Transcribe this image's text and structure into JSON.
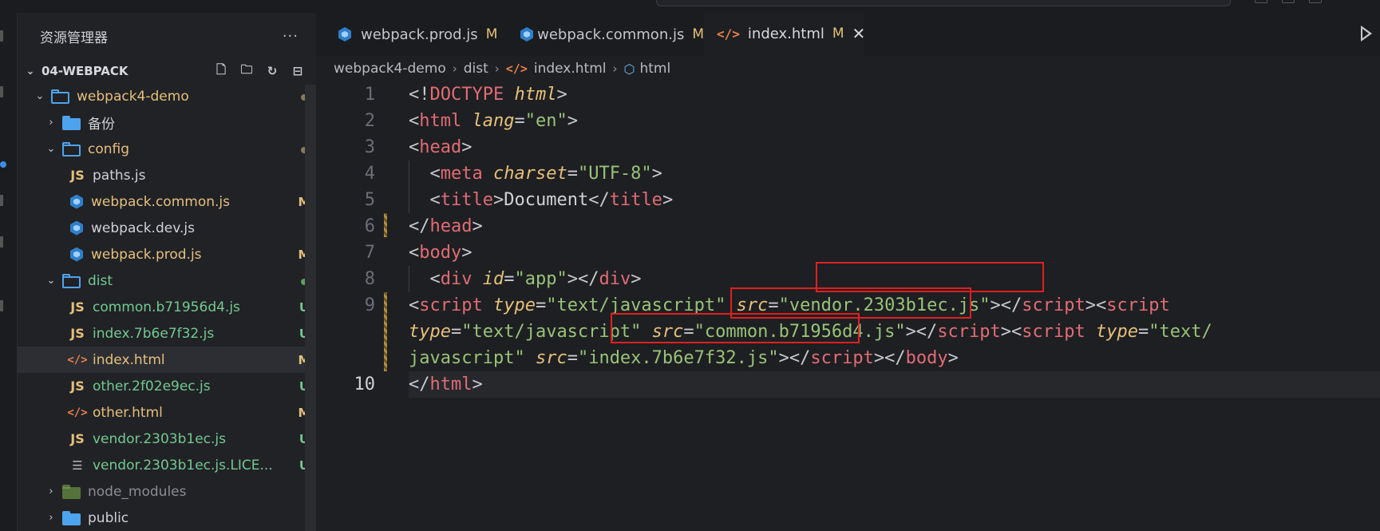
{
  "sidebar": {
    "title": "资源管理器",
    "more": "···",
    "section": "04-WEBPACK",
    "tree": [
      {
        "label": "webpack4-demo",
        "kind": "folder-outline",
        "chev": "⌄",
        "status": "dot",
        "color": "mod"
      },
      {
        "label": "备份",
        "kind": "folder",
        "chev": "›",
        "status": "",
        "color": "normal"
      },
      {
        "label": "config",
        "kind": "folder-outline",
        "chev": "⌄",
        "status": "dot",
        "color": "mod"
      },
      {
        "label": "paths.js",
        "kind": "js",
        "status": "",
        "color": "normal"
      },
      {
        "label": "webpack.common.js",
        "kind": "cube",
        "status": "M",
        "color": "mod"
      },
      {
        "label": "webpack.dev.js",
        "kind": "cube",
        "status": "",
        "color": "normal"
      },
      {
        "label": "webpack.prod.js",
        "kind": "cube",
        "status": "M",
        "color": "mod"
      },
      {
        "label": "dist",
        "kind": "folder-outline",
        "chev": "⌄",
        "status": "dot",
        "color": "untracked"
      },
      {
        "label": "common.b71956d4.js",
        "kind": "js",
        "status": "U",
        "color": "untracked"
      },
      {
        "label": "index.7b6e7f32.js",
        "kind": "js",
        "status": "U",
        "color": "untracked"
      },
      {
        "label": "index.html",
        "kind": "html",
        "status": "M",
        "color": "mod",
        "selected": true
      },
      {
        "label": "other.2f02e9ec.js",
        "kind": "js",
        "status": "U",
        "color": "untracked"
      },
      {
        "label": "other.html",
        "kind": "html",
        "status": "M",
        "color": "mod"
      },
      {
        "label": "vendor.2303b1ec.js",
        "kind": "js",
        "status": "U",
        "color": "untracked"
      },
      {
        "label": "vendor.2303b1ec.js.LICE...",
        "kind": "txt",
        "status": "U",
        "color": "untracked"
      },
      {
        "label": "node_modules",
        "kind": "folder-node",
        "chev": "›",
        "status": "",
        "color": "dim"
      },
      {
        "label": "public",
        "kind": "folder",
        "chev": "›",
        "status": "",
        "color": "normal"
      }
    ]
  },
  "tabs": [
    {
      "label": "webpack.prod.js",
      "badge": "M"
    },
    {
      "label": "webpack.common.js",
      "badge": "M"
    },
    {
      "label": "index.html",
      "badge": "M",
      "close": "✕"
    }
  ],
  "breadcrumb": {
    "parts": [
      "webpack4-demo",
      "dist",
      "index.html",
      "html"
    ]
  },
  "code": {
    "line_numbers": [
      "1",
      "2",
      "3",
      "4",
      "5",
      "6",
      "7",
      "8",
      "9",
      "",
      "",
      "10"
    ]
  }
}
